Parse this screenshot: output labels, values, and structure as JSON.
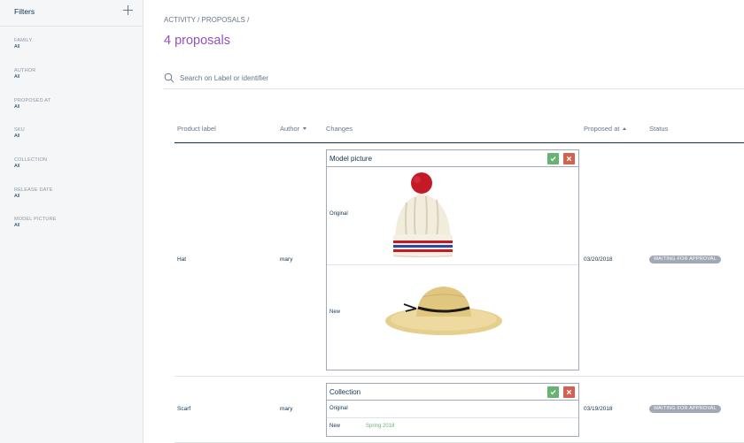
{
  "sidebar": {
    "title": "Filters",
    "filters": [
      {
        "label": "FAMILY",
        "value": "All"
      },
      {
        "label": "AUTHOR",
        "value": "All"
      },
      {
        "label": "PROPOSED AT",
        "value": "All"
      },
      {
        "label": "SKU",
        "value": "All"
      },
      {
        "label": "COLLECTION",
        "value": "All"
      },
      {
        "label": "RELEASE DATE",
        "value": "All"
      },
      {
        "label": "MODEL PICTURE",
        "value": "All"
      }
    ]
  },
  "breadcrumb": [
    "ACTIVITY",
    "PROPOSALS"
  ],
  "page_title": "4 proposals",
  "search": {
    "placeholder": "Search on Label or identifier",
    "value": ""
  },
  "table": {
    "columns": {
      "product_label": "Product label",
      "author": "Author",
      "changes": "Changes",
      "proposed_at": "Proposed at",
      "status": "Status"
    },
    "rows": [
      {
        "product_label": "Hat",
        "author": "mary",
        "change_title": "Model picture",
        "original_label": "Original",
        "new_label": "New",
        "original_image": "knitted-beanie-with-red-pompom",
        "new_image": "straw-sun-hat",
        "proposed_at": "03/20/2018",
        "status": "WAITING FOR APPROVAL"
      },
      {
        "product_label": "Scarf",
        "author": "mary",
        "change_title": "Collection",
        "original_label": "Original",
        "original_value": "",
        "new_label": "New",
        "new_value": "Spring 2018",
        "proposed_at": "03/19/2018",
        "status": "WAITING FOR APPROVAL"
      }
    ]
  },
  "colors": {
    "accent": "#9452ba",
    "approve": "#67b373",
    "reject": "#d4604f",
    "badge": "#a1a9b7",
    "text": "#11324d"
  }
}
